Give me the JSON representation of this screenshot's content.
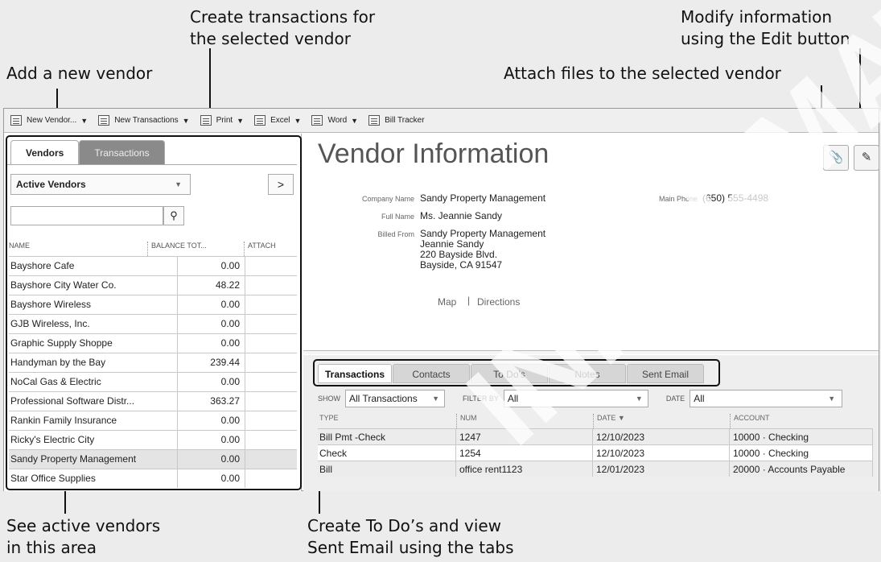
{
  "callouts": {
    "add_vendor": "Add a new vendor",
    "create_transactions": "Create transactions for\nthe selected vendor",
    "attach_files": "Attach files to the selected vendor",
    "modify_info": "Modify information\nusing the Edit button",
    "see_active": "See active vendors\nin this area",
    "create_todos": "Create To Do’s and view\nSent Email using the tabs"
  },
  "toolbar": {
    "new_vendor": "New Vendor...",
    "new_transactions": "New Transactions",
    "print": "Print",
    "excel": "Excel",
    "word": "Word",
    "bill_tracker": "Bill Tracker"
  },
  "left_panel": {
    "tab_vendors": "Vendors",
    "tab_transactions": "Transactions",
    "filter_value": "Active Vendors",
    "next_label": ">",
    "search_placeholder": "",
    "columns": {
      "name": "NAME",
      "balance": "BALANCE TOT...",
      "attach": "ATTACH"
    },
    "vendors": [
      {
        "name": "Bayshore Cafe",
        "balance": "0.00"
      },
      {
        "name": "Bayshore City Water Co.",
        "balance": "48.22"
      },
      {
        "name": "Bayshore Wireless",
        "balance": "0.00"
      },
      {
        "name": "GJB Wireless, Inc.",
        "balance": "0.00"
      },
      {
        "name": "Graphic Supply Shoppe",
        "balance": "0.00"
      },
      {
        "name": "Handyman by the Bay",
        "balance": "239.44"
      },
      {
        "name": "NoCal Gas & Electric",
        "balance": "0.00"
      },
      {
        "name": "Professional Software Distr...",
        "balance": "363.27"
      },
      {
        "name": "Rankin Family Insurance",
        "balance": "0.00"
      },
      {
        "name": "Ricky's Electric City",
        "balance": "0.00"
      },
      {
        "name": "Sandy Property Management",
        "balance": "0.00"
      },
      {
        "name": "Star Office Supplies",
        "balance": "0.00"
      }
    ]
  },
  "vendor_info": {
    "title": "Vendor Information",
    "company_name_label": "Company Name",
    "company_name": "Sandy Property Management",
    "full_name_label": "Full Name",
    "full_name": "Ms. Jeannie  Sandy",
    "billed_from_label": "Billed From",
    "billed_from": "Sandy Property Management\nJeannie Sandy\n220 Bayside Blvd.\nBayside, CA 91547",
    "main_phone_label": "Main Phone",
    "main_phone": "(650) 555-4498",
    "map_link": "Map",
    "directions_link": "Directions"
  },
  "bottom_tabs": [
    "Transactions",
    "Contacts",
    "To Do's",
    "Notes",
    "Sent Email"
  ],
  "filters": {
    "show_label": "SHOW",
    "show_value": "All Transactions",
    "filter_by_label": "FILTER BY",
    "filter_by_value": "All",
    "date_label": "DATE",
    "date_value": "All"
  },
  "transactions": {
    "columns": {
      "type": "TYPE",
      "num": "NUM",
      "date": "DATE",
      "account": "ACCOUNT"
    },
    "rows": [
      {
        "type": "Bill Pmt -Check",
        "num": "1247",
        "date": "12/10/2023",
        "account": "10000 · Checking"
      },
      {
        "type": "Check",
        "num": "1254",
        "date": "12/10/2023",
        "account": "10000 · Checking"
      },
      {
        "type": "Bill",
        "num": "office rent1123",
        "date": "12/01/2023",
        "account": "20000 · Accounts Payable"
      }
    ]
  },
  "watermark": "INFORMATION ONLY",
  "colors": {
    "window_bg": "#ffffff",
    "page_bg": "#ececec",
    "tab_inactive": "#8a8a8a"
  }
}
